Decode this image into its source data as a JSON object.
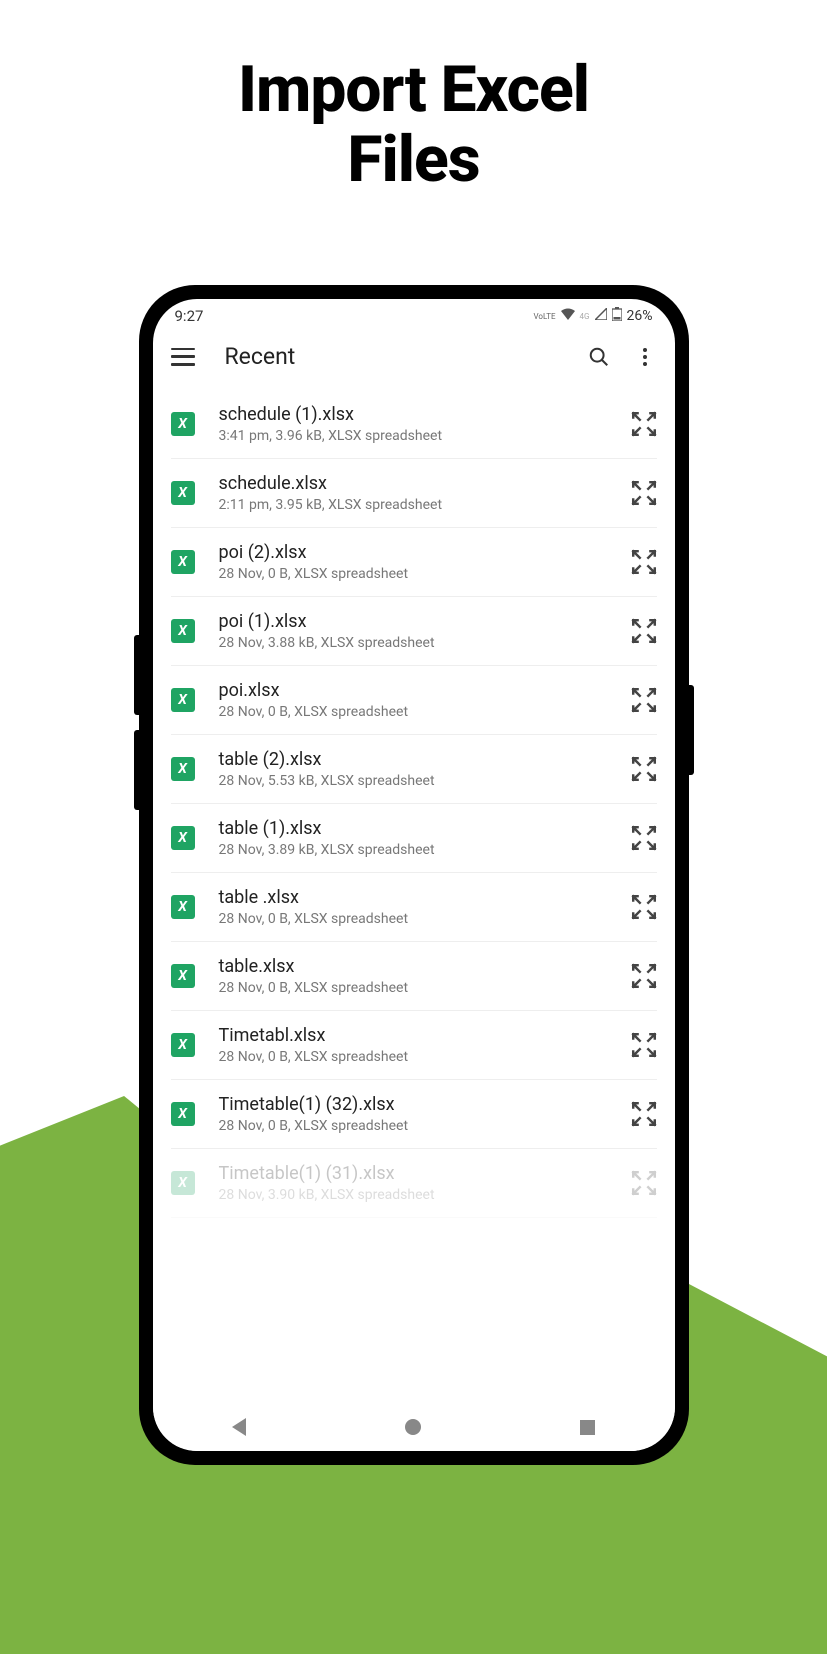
{
  "promo": {
    "line1": "Import Excel",
    "line2": "Files"
  },
  "status": {
    "time": "9:27",
    "lte": "VoLTE",
    "net": "4G",
    "battery": "26%"
  },
  "appbar": {
    "title": "Recent"
  },
  "files": [
    {
      "name": "schedule (1).xlsx",
      "meta": "3:41 pm, 3.96 kB, XLSX spreadsheet"
    },
    {
      "name": "schedule.xlsx",
      "meta": "2:11 pm, 3.95 kB, XLSX spreadsheet"
    },
    {
      "name": "poi (2).xlsx",
      "meta": "28 Nov, 0 B, XLSX spreadsheet"
    },
    {
      "name": "poi (1).xlsx",
      "meta": "28 Nov, 3.88 kB, XLSX spreadsheet"
    },
    {
      "name": "poi.xlsx",
      "meta": "28 Nov, 0 B, XLSX spreadsheet"
    },
    {
      "name": "table (2).xlsx",
      "meta": "28 Nov, 5.53 kB, XLSX spreadsheet"
    },
    {
      "name": "table (1).xlsx",
      "meta": "28 Nov, 3.89 kB, XLSX spreadsheet"
    },
    {
      "name": "table .xlsx",
      "meta": "28 Nov, 0 B, XLSX spreadsheet"
    },
    {
      "name": "table.xlsx",
      "meta": "28 Nov, 0 B, XLSX spreadsheet"
    },
    {
      "name": "Timetabl.xlsx",
      "meta": "28 Nov, 0 B, XLSX spreadsheet"
    },
    {
      "name": "Timetable(1) (32).xlsx",
      "meta": "28 Nov, 0 B, XLSX spreadsheet"
    },
    {
      "name": "Timetable(1) (31).xlsx",
      "meta": "28 Nov, 3.90 kB, XLSX spreadsheet"
    }
  ],
  "icon_label": "X"
}
